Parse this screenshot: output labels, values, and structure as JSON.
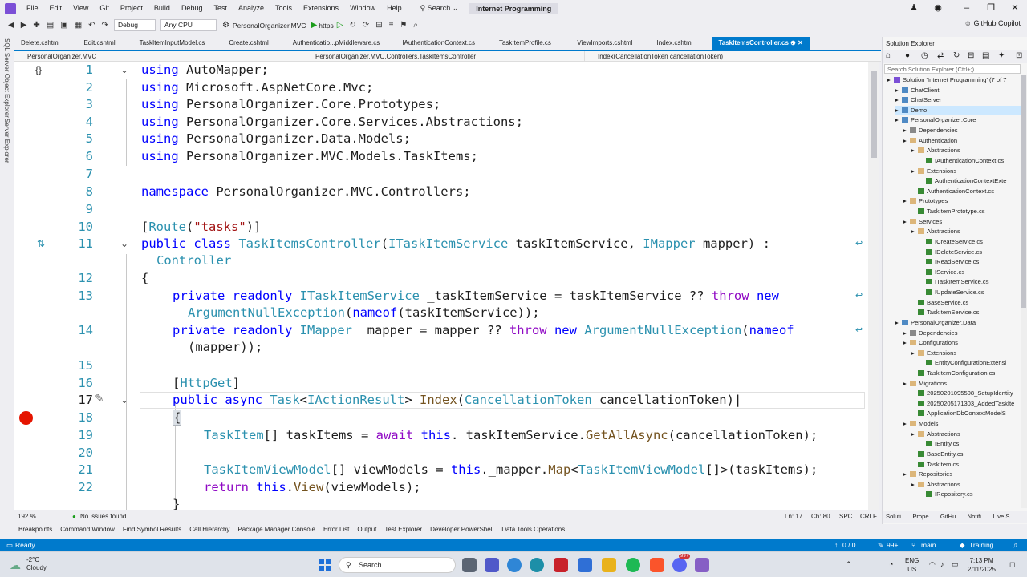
{
  "menu": [
    "File",
    "Edit",
    "View",
    "Git",
    "Project",
    "Build",
    "Debug",
    "Test",
    "Analyze",
    "Tools",
    "Extensions",
    "Window",
    "Help"
  ],
  "search_menu": "Search",
  "solution_title": "Internet Programming",
  "copilot": "GitHub Copilot",
  "toolbar": {
    "config": "Debug",
    "platform": "Any CPU",
    "startup": "PersonalOrganizer.MVC",
    "run_profile": "https"
  },
  "left_rail": [
    "SQL Server Object Explorer",
    "Server Explorer"
  ],
  "doc_tabs": [
    "Delete.cshtml",
    "Edit.cshtml",
    "TaskItemInputModel.cs",
    "Create.cshtml",
    "Authenticatio...pMiddleware.cs",
    "IAuthenticationContext.cs",
    "TaskItemProfile.cs",
    "_ViewImports.cshtml",
    "Index.cshtml",
    "TaskItemsController.cs"
  ],
  "nav": {
    "project": "PersonalOrganizer.MVC",
    "class": "PersonalOrganizer.MVC.Controllers.TaskItemsController",
    "member": "Index(CancellationToken cancellationToken)"
  },
  "line_numbers": [
    "1",
    "2",
    "3",
    "4",
    "5",
    "6",
    "7",
    "8",
    "9",
    "10",
    "11",
    "12",
    "13",
    "14",
    "15",
    "16",
    "17",
    "18",
    "19",
    "20",
    "21",
    "22"
  ],
  "code": {
    "using1": "AutoMapper;",
    "using2": "Microsoft.AspNetCore.Mvc;",
    "using3": "PersonalOrganizer.Core.Prototypes;",
    "using4": "PersonalOrganizer.Core.Services.Abstractions;",
    "using5": "PersonalOrganizer.Data.Models;",
    "using6": "PersonalOrganizer.MVC.Models.TaskItems;",
    "ns": "PersonalOrganizer.MVC.Controllers;",
    "route_str": "\"tasks\"",
    "class_name": "TaskItemsController",
    "param1_type": "ITaskItemService",
    "param1": " taskItemService, ",
    "param2_type": "IMapper",
    "param2": " mapper) :",
    "base": "Controller",
    "field1_type": "ITaskItemService",
    "field1": " _taskItemService = taskItemService ?? ",
    "ane": "ArgumentNullException",
    "field1_end": "(taskItemService));",
    "field2_type": "IMapper",
    "field2": " _mapper = mapper ?? ",
    "field2_end": "(mapper));",
    "attr": "HttpGet",
    "task": "Task",
    "iar": "IActionResult",
    "index": "Index",
    "ct_type": "CancellationToken",
    "ct": " cancellationToken)",
    "l19_type": "TaskItem",
    "l19_a": "[] taskItems = ",
    "l19_b": "._taskItemService.",
    "l19_m": "GetAllAsync",
    "l19_c": "(cancellationToken);",
    "l21_type": "TaskItemViewModel",
    "l21_a": "[] viewModels = ",
    "l21_b": "._mapper.",
    "l21_m": "Map",
    "l21_c": "[]>(taskItems);",
    "l22_m": "View",
    "l22_c": "(viewModels);"
  },
  "editor_status": {
    "zoom": "192 %",
    "issues": "No issues found",
    "ln": "Ln: 17",
    "ch": "Ch: 80",
    "spc": "SPC",
    "crlf": "CRLF"
  },
  "tool_tabs": [
    "Breakpoints",
    "Command Window",
    "Find Symbol Results",
    "Call Hierarchy",
    "Package Manager Console",
    "Error List",
    "Output",
    "Test Explorer",
    "Developer PowerShell",
    "Data Tools Operations"
  ],
  "solution_explorer": {
    "title": "Solution Explorer",
    "search_placeholder": "Search Solution Explorer (Ctrl+;)",
    "items": [
      {
        "label": "Solution 'Internet Programming' (7 of 7",
        "indent": 0,
        "icon": "sln"
      },
      {
        "label": "ChatClient",
        "indent": 1,
        "icon": "proj"
      },
      {
        "label": "ChatServer",
        "indent": 1,
        "icon": "proj"
      },
      {
        "label": "Demo",
        "indent": 1,
        "icon": "proj",
        "selected": true
      },
      {
        "label": "PersonalOrganizer.Core",
        "indent": 1,
        "icon": "proj"
      },
      {
        "label": "Dependencies",
        "indent": 2,
        "icon": "dep"
      },
      {
        "label": "Authentication",
        "indent": 2,
        "icon": "folder"
      },
      {
        "label": "Abstractions",
        "indent": 3,
        "icon": "folder"
      },
      {
        "label": "IAuthenticationContext.cs",
        "indent": 4,
        "icon": "cs"
      },
      {
        "label": "Extensions",
        "indent": 3,
        "icon": "folder"
      },
      {
        "label": "AuthenticationContextExte",
        "indent": 4,
        "icon": "cs"
      },
      {
        "label": "AuthenticationContext.cs",
        "indent": 3,
        "icon": "cs"
      },
      {
        "label": "Prototypes",
        "indent": 2,
        "icon": "folder"
      },
      {
        "label": "TaskItemPrototype.cs",
        "indent": 3,
        "icon": "cs"
      },
      {
        "label": "Services",
        "indent": 2,
        "icon": "folder"
      },
      {
        "label": "Abstractions",
        "indent": 3,
        "icon": "folder"
      },
      {
        "label": "ICreateService.cs",
        "indent": 4,
        "icon": "cs"
      },
      {
        "label": "IDeleteService.cs",
        "indent": 4,
        "icon": "cs"
      },
      {
        "label": "IReadService.cs",
        "indent": 4,
        "icon": "cs"
      },
      {
        "label": "IService.cs",
        "indent": 4,
        "icon": "cs"
      },
      {
        "label": "ITaskItemService.cs",
        "indent": 4,
        "icon": "cs"
      },
      {
        "label": "IUpdateService.cs",
        "indent": 4,
        "icon": "cs"
      },
      {
        "label": "BaseService.cs",
        "indent": 3,
        "icon": "cs"
      },
      {
        "label": "TaskItemService.cs",
        "indent": 3,
        "icon": "cs"
      },
      {
        "label": "PersonalOrganizer.Data",
        "indent": 1,
        "icon": "proj"
      },
      {
        "label": "Dependencies",
        "indent": 2,
        "icon": "dep"
      },
      {
        "label": "Configurations",
        "indent": 2,
        "icon": "folder"
      },
      {
        "label": "Extensions",
        "indent": 3,
        "icon": "folder"
      },
      {
        "label": "EntityConfigurationExtensi",
        "indent": 4,
        "icon": "cs"
      },
      {
        "label": "TaskItemConfiguration.cs",
        "indent": 3,
        "icon": "cs"
      },
      {
        "label": "Migrations",
        "indent": 2,
        "icon": "folder"
      },
      {
        "label": "20250201095508_SetupIdentity",
        "indent": 3,
        "icon": "cs"
      },
      {
        "label": "20250205171303_AddedTaskIte",
        "indent": 3,
        "icon": "cs"
      },
      {
        "label": "ApplicationDbContextModelS",
        "indent": 3,
        "icon": "cs"
      },
      {
        "label": "Models",
        "indent": 2,
        "icon": "folder"
      },
      {
        "label": "Abstractions",
        "indent": 3,
        "icon": "folder"
      },
      {
        "label": "IEntity.cs",
        "indent": 4,
        "icon": "cs"
      },
      {
        "label": "BaseEntity.cs",
        "indent": 3,
        "icon": "cs"
      },
      {
        "label": "TaskItem.cs",
        "indent": 3,
        "icon": "cs"
      },
      {
        "label": "Repositories",
        "indent": 2,
        "icon": "folder"
      },
      {
        "label": "Abstractions",
        "indent": 3,
        "icon": "folder"
      },
      {
        "label": "IRepository.cs",
        "indent": 4,
        "icon": "cs"
      }
    ],
    "tabs": [
      "Soluti...",
      "Prope...",
      "GitHu...",
      "Notifi...",
      "Live S..."
    ]
  },
  "status_bar": {
    "ready": "Ready",
    "counter": "0 / 0",
    "changes": "99+",
    "branch": "main",
    "repo": "Training"
  },
  "taskbar": {
    "temp": "-2°C",
    "weather": "Cloudy",
    "search": "Search",
    "lang1": "ENG",
    "lang2": "US",
    "time": "7:13 PM",
    "date": "2/11/2025",
    "badge": "99+"
  },
  "colors": {
    "accent": "#007acc",
    "keyword": "#0000ff",
    "type": "#2b91af",
    "string": "#a31515",
    "method": "#74531f",
    "control": "#8f08c4",
    "breakpoint": "#e51400"
  }
}
